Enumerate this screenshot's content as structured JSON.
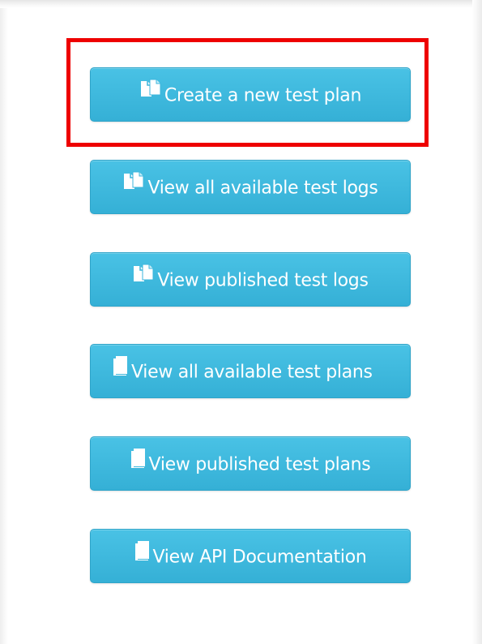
{
  "buttons": [
    {
      "label": "Create a new test plan",
      "icon": "copy-files-icon"
    },
    {
      "label": "View all available test logs",
      "icon": "copy-files-icon"
    },
    {
      "label": "View published test logs",
      "icon": "copy-files-icon"
    },
    {
      "label": "View all available test plans",
      "icon": "file-icon"
    },
    {
      "label": "View published test plans",
      "icon": "file-icon"
    },
    {
      "label": "View API Documentation",
      "icon": "file-icon"
    }
  ],
  "highlight": {
    "target": "Create a new test plan",
    "color": "#ee0000"
  },
  "colors": {
    "button": "#3bb6dc",
    "button_text": "#ffffff"
  }
}
